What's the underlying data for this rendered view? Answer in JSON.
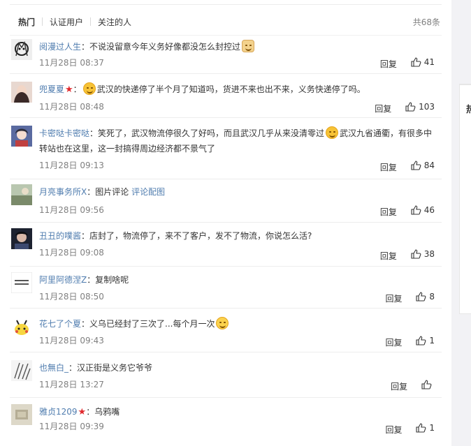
{
  "tabs": [
    {
      "label": "热门",
      "active": true
    },
    {
      "label": "认证用户",
      "active": false
    },
    {
      "label": "关注的人",
      "active": false
    }
  ],
  "total": "共68条",
  "reply_label": "回复",
  "right_card_glyph": "热",
  "comments": [
    {
      "user": "阅漫过人生",
      "text": "不说没留意今年义务好像都没怎么封控过",
      "time": "11月28日 08:37",
      "likes": "41"
    },
    {
      "user": "兜夏夏",
      "text": "武汉的快递停了半个月了知道吗，货进不来也出不来，义务快递停了吗。",
      "time": "11月28日 08:48",
      "likes": "103"
    },
    {
      "user": "卡密哒卡密哒",
      "text1": "笑死了，武汉物流停很久了好吗，而且武汉几乎从来没清零过",
      "text2": "武汉九省通衢，有很多中",
      "line2": "转站也在这里，这一封搞得周边经济都不景气了",
      "time": "11月28日 09:13",
      "likes": "84"
    },
    {
      "user": "月亮事务所X",
      "text": "图片评论",
      "link": "评论配图",
      "time": "11月28日 09:56",
      "likes": "46"
    },
    {
      "user": "丑丑的噗酱",
      "text": "店封了，物流停了，来不了客户，发不了物流，你说怎么活?",
      "time": "11月28日 09:08",
      "likes": "38"
    },
    {
      "user": "阿里阿德涅Z",
      "text": "复制啥呢",
      "time": "11月28日 08:50",
      "likes": "8"
    },
    {
      "user": "花七了个夏",
      "text": "义乌已经封了三次了...每个月一次",
      "time": "11月28日 09:43",
      "likes": "1"
    },
    {
      "user": "也無白_",
      "text": "汉正街是义务它爷爷",
      "time": "11月28日 13:27",
      "likes": ""
    },
    {
      "user": "雅贞1209",
      "text": "乌鸦嘴",
      "time": "11月28日 09:39",
      "likes": "1"
    }
  ],
  "colors": {
    "username": "#507daf",
    "accent": "#eb7350",
    "vip_star": "#e0282c",
    "muted": "#808080"
  },
  "icons": [
    "thumb-up-icon",
    "vip-star-icon",
    "smile-emoji-icon",
    "dog-emoji-icon",
    "cry-emoji-icon"
  ]
}
